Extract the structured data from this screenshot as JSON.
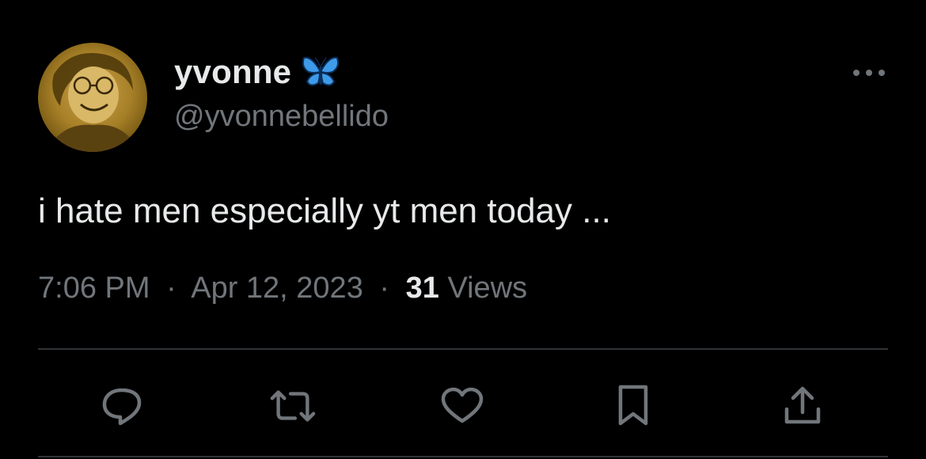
{
  "author": {
    "display_name": "yvonne",
    "handle": "@yvonnebellido",
    "badge_icon": "butterfly-emoji-icon",
    "avatar": "profile-photo"
  },
  "tweet": {
    "text": "i hate men especially yt men today ...",
    "time": "7:06 PM",
    "separator": "·",
    "date": "Apr 12, 2023",
    "views_count": "31",
    "views_label": "Views"
  },
  "actions": [
    {
      "name": "reply",
      "icon": "comment-bubble-icon"
    },
    {
      "name": "repost",
      "icon": "repost-arrows-icon"
    },
    {
      "name": "like",
      "icon": "heart-icon"
    },
    {
      "name": "bookmark",
      "icon": "bookmark-icon"
    },
    {
      "name": "share",
      "icon": "share-upload-icon"
    }
  ],
  "menu": {
    "icon": "more-dots-icon"
  },
  "colors": {
    "background": "#000000",
    "primary_text": "#e7e9ea",
    "secondary_text": "#71767b",
    "divider": "#2f3336",
    "butterfly": "#3d9be9"
  }
}
